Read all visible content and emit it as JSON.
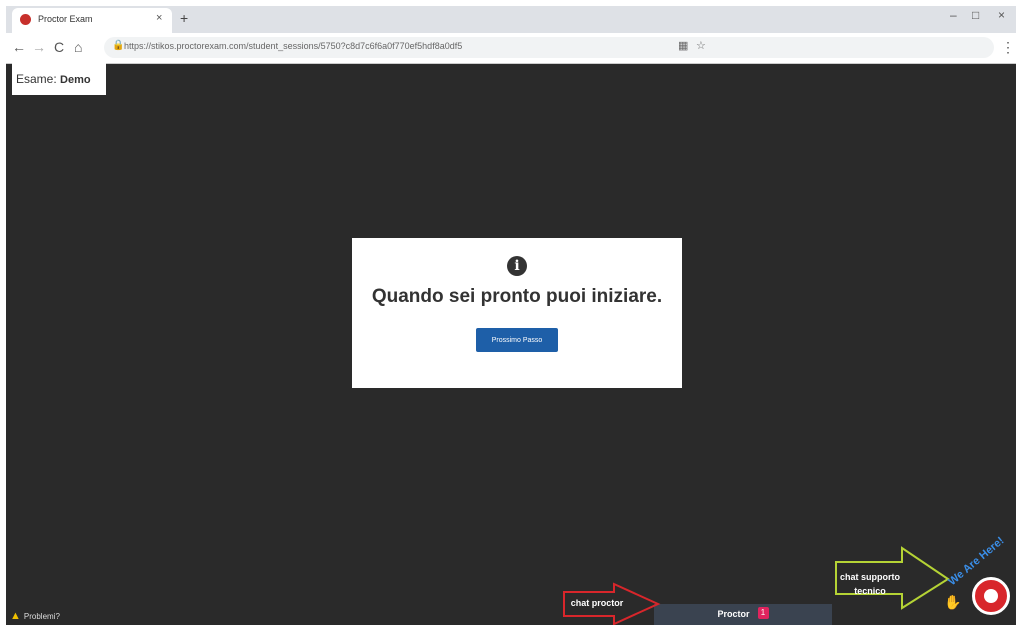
{
  "browser": {
    "tab_title": "Proctor Exam",
    "tab_close": "×",
    "new_tab": "+",
    "window_controls": [
      "–",
      "□",
      "×"
    ],
    "nav": {
      "back": "←",
      "forward": "→",
      "reload": "C",
      "home": "⌂"
    },
    "url": "https://stikos.proctorexam.com/student_sessions/5750?c8d7c6f6a0f770ef5hdf8a0df5",
    "lock_icon": "lock-icon",
    "menu": "⋮"
  },
  "page": {
    "exam_prefix": "Esame:",
    "exam_name": "Demo",
    "modal": {
      "icon": "ⅰ",
      "message": "Quando sei pronto puoi iniziare.",
      "button": "Prossimo Passo"
    },
    "warning_label": "Problemi?",
    "proctor_label": "Proctor",
    "proctor_count": "1"
  },
  "annotations": {
    "chat_proctor": "chat proctor",
    "chat_supporto_line1": "chat supporto",
    "chat_supporto_line2": "tecnico",
    "we_are_here": "We Are Here!",
    "colors": {
      "red": "#d8262b",
      "green": "#b5d335"
    }
  }
}
